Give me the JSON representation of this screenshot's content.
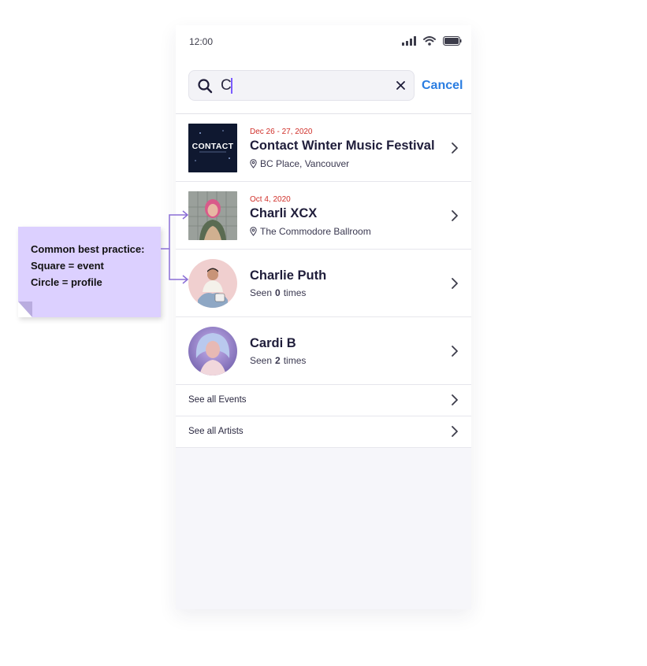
{
  "status_bar": {
    "time": "12:00",
    "icons": [
      "signal-icon",
      "wifi-icon",
      "battery-icon"
    ]
  },
  "search": {
    "value": "C",
    "clear_icon": "close-icon",
    "cancel_label": "Cancel"
  },
  "results": [
    {
      "kind": "event",
      "thumb": "square",
      "date": "Dec 26 - 27, 2020",
      "title": "Contact Winter Music Festival",
      "venue": "BC Place, Vancouver",
      "thumb_text": "CONTACT"
    },
    {
      "kind": "event",
      "thumb": "square",
      "date": "Oct 4, 2020",
      "title": "Charli XCX",
      "venue": "The Commodore Ballroom"
    },
    {
      "kind": "profile",
      "thumb": "circle",
      "title": "Charlie Puth",
      "seen_prefix": "Seen",
      "seen_count": "0",
      "seen_suffix": "times"
    },
    {
      "kind": "profile",
      "thumb": "circle",
      "title": "Cardi B",
      "seen_prefix": "Seen",
      "seen_count": "2",
      "seen_suffix": "times"
    }
  ],
  "links": [
    {
      "label": "See all Events"
    },
    {
      "label": "See all Artists"
    }
  ],
  "annotation": {
    "line1": "Common best practice:",
    "line2": "Square = event",
    "line3": "Circle = profile"
  },
  "colors": {
    "accent": "#2a7de1",
    "date": "#d0302a",
    "note": "#dcd0ff",
    "arrow": "#8b6fd6"
  }
}
